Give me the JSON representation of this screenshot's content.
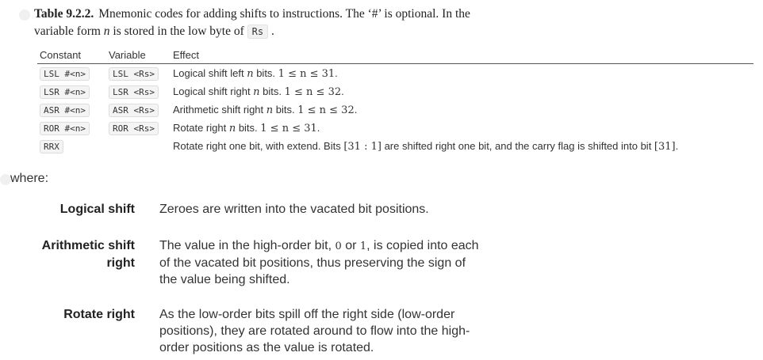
{
  "caption": {
    "number": "Table 9.2.2.",
    "text": "Mnemonic codes for adding shifts to instructions. The ‘#’ is optional. In the variable form ",
    "var_n": "n",
    "text2": " is stored in the low byte of ",
    "register": "Rs",
    "end": "."
  },
  "table": {
    "headers": [
      "Constant",
      "Variable",
      "Effect"
    ],
    "rows": [
      {
        "constant": "LSL #<n>",
        "variable": "LSL <Rs>",
        "effect": "Logical shift left ",
        "n": "n",
        "effect2": " bits. ",
        "range": "1 ≤ n ≤ 31",
        "end": "."
      },
      {
        "constant": "LSR #<n>",
        "variable": "LSR <Rs>",
        "effect": "Logical shift right ",
        "n": "n",
        "effect2": " bits. ",
        "range": "1 ≤ n ≤ 32",
        "end": "."
      },
      {
        "constant": "ASR #<n>",
        "variable": "ASR <Rs>",
        "effect": "Arithmetic shift right ",
        "n": "n",
        "effect2": " bits. ",
        "range": "1 ≤ n ≤ 32",
        "end": "."
      },
      {
        "constant": "ROR #<n>",
        "variable": "ROR <Rs>",
        "effect": "Rotate right ",
        "n": "n",
        "effect2": " bits. ",
        "range": "1 ≤ n ≤ 31",
        "end": "."
      },
      {
        "constant": "RRX",
        "variable": "",
        "effect": "Rotate right one bit, with extend. Bits ",
        "bits": "[31 : 1]",
        "effect2": " are shifted right one bit, and the carry flag is shifted into bit ",
        "bit": "[31]",
        "end": "."
      }
    ]
  },
  "where_label": "where:",
  "definitions": [
    {
      "term_lines": [
        "Logical shift"
      ],
      "desc_a": "Zeroes are written into the vacated bit positions."
    },
    {
      "term_lines": [
        "Arithmetic shift",
        "right"
      ],
      "desc_a": "The value in the high-order bit, ",
      "zero": "0",
      "or": " or ",
      "one": "1",
      "desc_b": ", is copied into each of the vacated bit positions, thus preserving the sign of the value being shifted."
    },
    {
      "term_lines": [
        "Rotate right"
      ],
      "desc_a": "As the low-order bits spill off the right side (low-order positions), they are rotated around to flow into the high-order positions as the value is rotated."
    }
  ]
}
